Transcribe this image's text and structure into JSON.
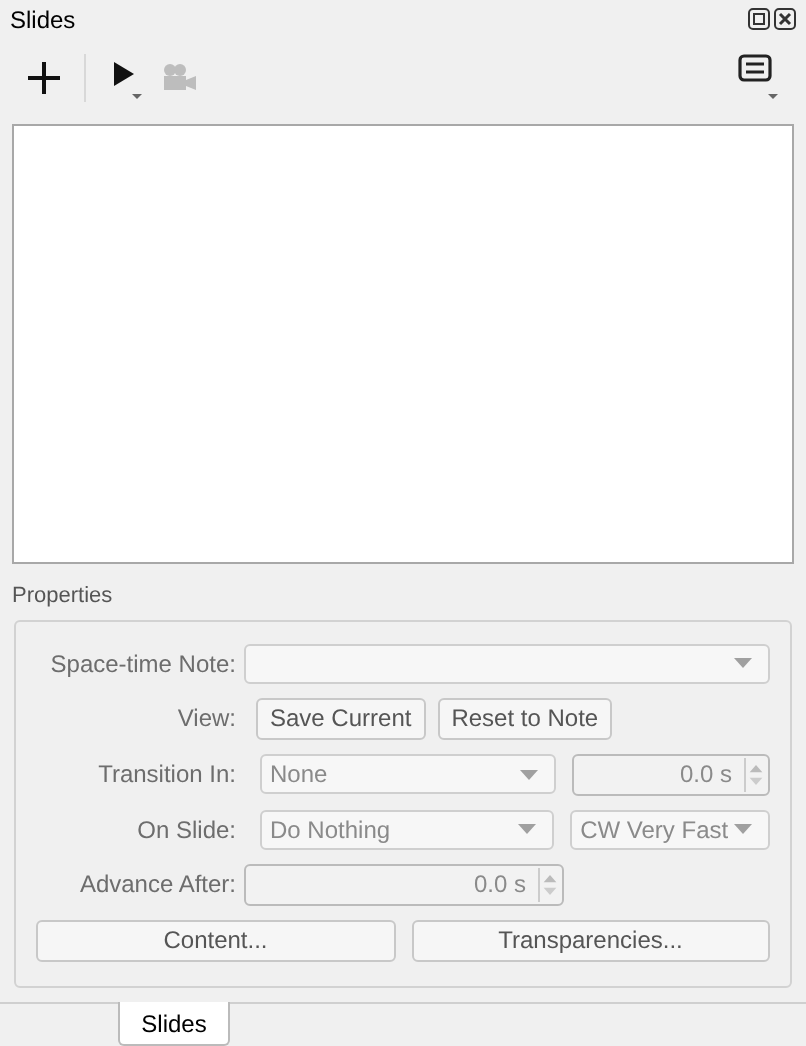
{
  "window": {
    "title": "Slides"
  },
  "toolbar": [
    {
      "kind": "add",
      "disabled": false
    },
    {
      "kind": "play",
      "disabled": false
    },
    {
      "kind": "camera",
      "disabled": true
    }
  ],
  "properties": {
    "title": "Properties",
    "disabled": true,
    "space_time_note": {
      "label": "Space-time Note:"
    },
    "view": {
      "label": "View:",
      "buttons": [
        "Save Current",
        "Reset to Note"
      ]
    },
    "transition_in": {
      "label": "Transition In:",
      "value": "None",
      "duration": "0.0 s"
    },
    "on_slide": {
      "label": "On Slide:",
      "value": "Do Nothing",
      "speed": "CW Very Fast"
    },
    "advance_after": {
      "label": "Advance After:",
      "duration": "0.0 s"
    },
    "buttons": [
      "Content...",
      "Transparencies..."
    ]
  },
  "bottom_tabs": [
    {
      "label": "Slides",
      "selected": true
    }
  ]
}
